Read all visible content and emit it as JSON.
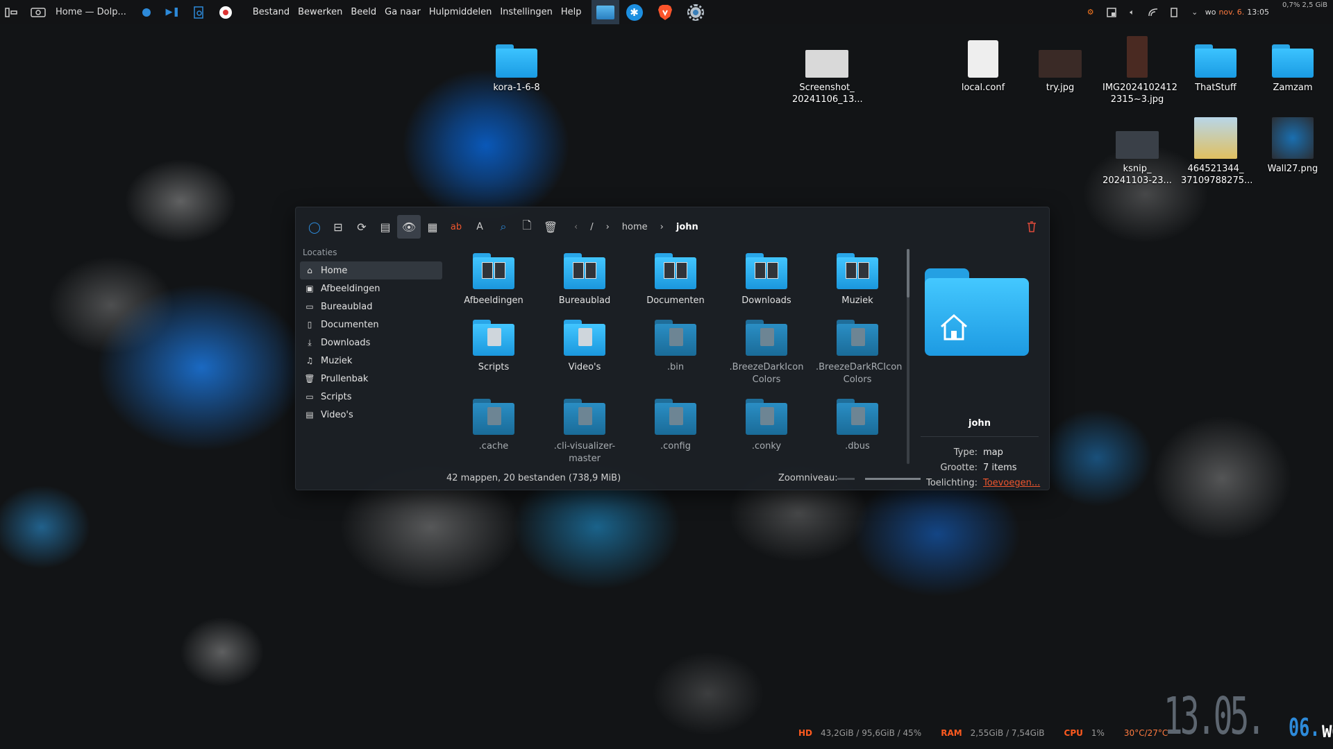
{
  "topbar": {
    "window_title": "Home — Dolp...",
    "menu": [
      "Bestand",
      "Bewerken",
      "Beeld",
      "Ga naar",
      "Hulpmiddelen",
      "Instellingen",
      "Help"
    ],
    "datetime": "wo nov. 6. 13:05",
    "date_day": "wo",
    "date_month": "nov. 6.",
    "time": "13:05",
    "sysmon": "0,7% 2,5 GiB"
  },
  "desktop": {
    "icons": [
      {
        "label": "kora-1-6-8",
        "kind": "folder"
      },
      {
        "label": "Screenshot_\n20241106_13...",
        "kind": "image"
      },
      {
        "label": "local.conf",
        "kind": "file"
      },
      {
        "label": "try.jpg",
        "kind": "image"
      },
      {
        "label": "IMG2024102412\n2315~3.jpg",
        "kind": "image"
      },
      {
        "label": "ThatStuff",
        "kind": "folder"
      },
      {
        "label": "Zamzam",
        "kind": "folder"
      },
      {
        "label": "ksnip_\n20241103-23...",
        "kind": "image"
      },
      {
        "label": "464521344_\n37109788275...",
        "kind": "image"
      },
      {
        "label": "Wall27.png",
        "kind": "image"
      }
    ]
  },
  "dolphin": {
    "breadcrumb": [
      "/",
      "home",
      "john"
    ],
    "sidebar": {
      "heading": "Locaties",
      "items": [
        {
          "label": "Home",
          "icon": "home-icon"
        },
        {
          "label": "Afbeeldingen",
          "icon": "image-icon"
        },
        {
          "label": "Bureaublad",
          "icon": "desktop-icon"
        },
        {
          "label": "Documenten",
          "icon": "document-icon"
        },
        {
          "label": "Downloads",
          "icon": "download-icon"
        },
        {
          "label": "Muziek",
          "icon": "music-icon"
        },
        {
          "label": "Prullenbak",
          "icon": "trash-icon"
        },
        {
          "label": "Scripts",
          "icon": "folder-icon"
        },
        {
          "label": "Video's",
          "icon": "video-icon"
        }
      ]
    },
    "files": [
      {
        "name": "Afbeeldingen",
        "style": "bright"
      },
      {
        "name": "Bureaublad",
        "style": "bright"
      },
      {
        "name": "Documenten",
        "style": "bright"
      },
      {
        "name": "Downloads",
        "style": "bright"
      },
      {
        "name": "Muziek",
        "style": "bright"
      },
      {
        "name": "Scripts",
        "style": "bright"
      },
      {
        "name": "Video's",
        "style": "bright"
      },
      {
        "name": ".bin",
        "style": "dim"
      },
      {
        "name": ".BreezeDarkIcon\nColors",
        "style": "dim"
      },
      {
        "name": ".BreezeDarkRCIcon\nColors",
        "style": "dim"
      },
      {
        "name": ".cache",
        "style": "dim"
      },
      {
        "name": ".cli-visualizer-\nmaster",
        "style": "dim"
      },
      {
        "name": ".config",
        "style": "dim"
      },
      {
        "name": ".conky",
        "style": "dim"
      },
      {
        "name": ".dbus",
        "style": "dim"
      }
    ],
    "info": {
      "name": "john",
      "type_label": "Type:",
      "type_value": "map",
      "size_label": "Grootte:",
      "size_value": "7 items",
      "comment_label": "Toelichting:",
      "comment_value": "Toevoegen..."
    },
    "status": {
      "summary": "42 mappen, 20 bestanden (738,9 MiB)",
      "zoom_label": "Zoomniveau:"
    }
  },
  "stats": {
    "hd_label": "HD",
    "hd_value": "43,2GiB / 95,6GiB / 45%",
    "ram_label": "RAM",
    "ram_value": "2,55GiB / 7,54GiB",
    "cpu_label": "CPU",
    "cpu_value": "1%",
    "temp": "30°C/27°C"
  },
  "clock": {
    "time": "13.05.",
    "day": "06.",
    "weekday": "WO"
  },
  "colors": {
    "accent": "#2d8ad9",
    "folder": "#3cc3ff",
    "warn": "#ff5a1f"
  }
}
